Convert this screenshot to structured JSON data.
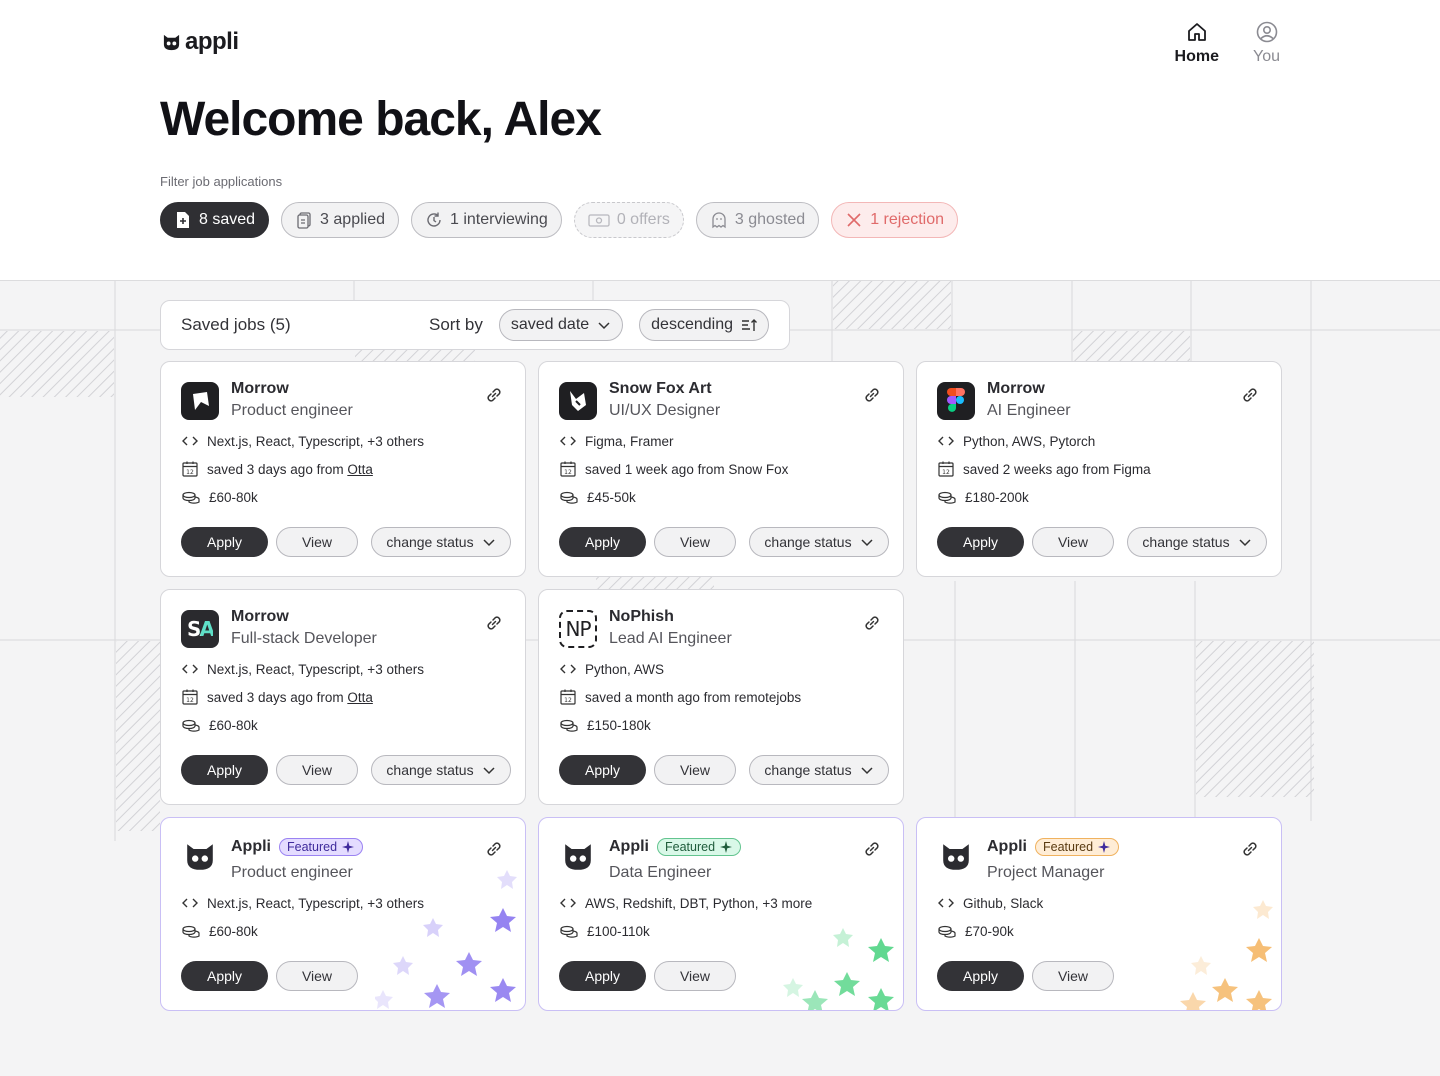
{
  "brand": {
    "name": "appli"
  },
  "nav": [
    {
      "label": "Home",
      "icon": "home-icon",
      "active": true
    },
    {
      "label": "You",
      "icon": "user-circle-icon",
      "active": false
    }
  ],
  "welcome": "Welcome back, Alex",
  "filter": {
    "label": "Filter job applications",
    "chips": [
      {
        "label": "8 saved",
        "icon": "bookmark-file-icon"
      },
      {
        "label": "3 applied",
        "icon": "documents-icon"
      },
      {
        "label": "1 interviewing",
        "icon": "refresh-clock-icon"
      },
      {
        "label": "0 offers",
        "icon": "cash-icon"
      },
      {
        "label": "3 ghosted",
        "icon": "ghost-icon"
      },
      {
        "label": "1 rejection",
        "icon": "close-icon"
      }
    ]
  },
  "sortbar": {
    "title": "Saved jobs (5)",
    "sort_label": "Sort by",
    "sort_field": "saved date",
    "sort_order": "descending"
  },
  "labels": {
    "apply": "Apply",
    "view": "View",
    "change_status": "change status",
    "featured": "Featured"
  },
  "jobs": [
    {
      "company": "Morrow",
      "role": "Product engineer",
      "skills": "Next.js, React, Typescript, +3 others",
      "saved_prefix": "saved 3 days ago from ",
      "saved_source": "Otta",
      "salary": "£60-80k"
    },
    {
      "company": "Snow Fox Art",
      "role": "UI/UX Designer",
      "skills": "Figma, Framer",
      "saved_prefix": "saved 1 week ago from Snow Fox",
      "saved_source": "",
      "salary": "£45-50k"
    },
    {
      "company": "Morrow",
      "role": "AI Engineer",
      "skills": "Python, AWS, Pytorch",
      "saved_prefix": "saved 2 weeks ago from Figma",
      "saved_source": "",
      "salary": "£180-200k"
    },
    {
      "company": "Morrow",
      "role": "Full-stack Developer",
      "skills": "Next.js, React, Typescript, +3 others",
      "saved_prefix": "saved 3 days ago from ",
      "saved_source": "Otta",
      "salary": "£60-80k",
      "logo_text": "SA"
    },
    {
      "company": "NoPhish",
      "role": "Lead AI Engineer",
      "skills": "Python, AWS",
      "saved_prefix": "saved a month ago from remotejobs",
      "saved_source": "",
      "salary": "£150-180k",
      "logo_text": "NP"
    }
  ],
  "featured": [
    {
      "company": "Appli",
      "role": "Product engineer",
      "skills": "Next.js, React, Typescript, +3 others",
      "salary": "£60-80k",
      "accent": "#8f7cf0"
    },
    {
      "company": "Appli",
      "role": "Data Engineer",
      "skills": "AWS, Redshift, DBT, Python, +3 more",
      "salary": "£100-110k",
      "accent": "#59d68a"
    },
    {
      "company": "Appli",
      "role": "Project Manager",
      "skills": "Github, Slack",
      "salary": "£70-90k",
      "accent": "#f5b766"
    }
  ]
}
